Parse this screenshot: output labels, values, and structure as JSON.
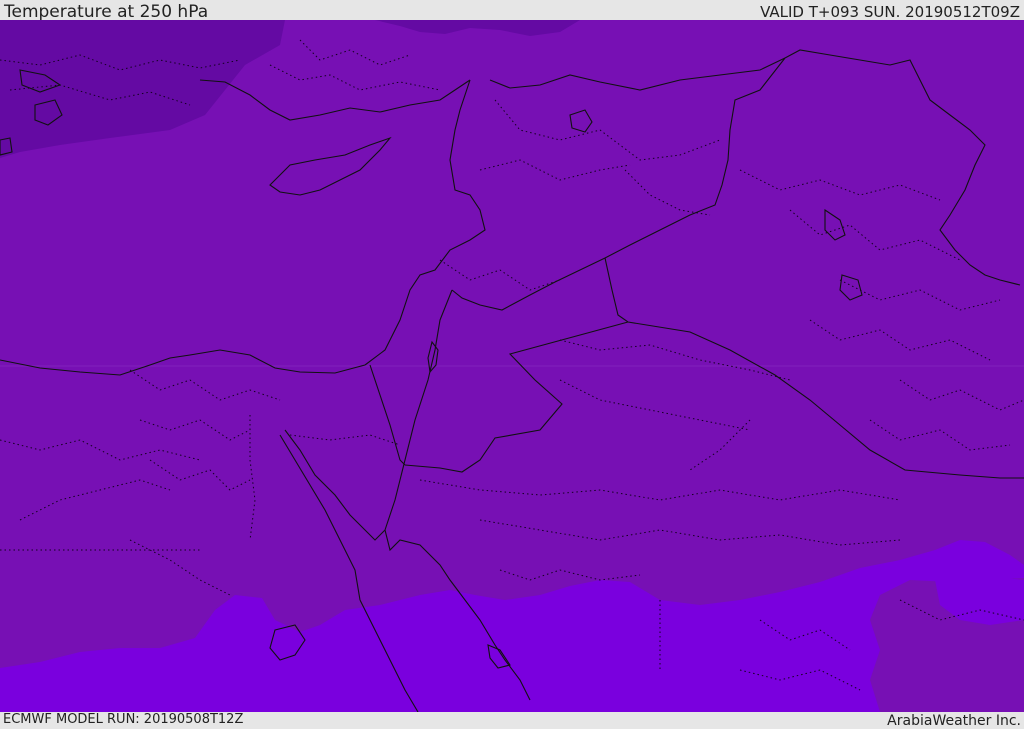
{
  "header": {
    "title": "Temperature at 250 hPa",
    "valid": "VALID T+093 SUN. 20190512T09Z"
  },
  "footer": {
    "model_run": "ECMWF MODEL RUN: 20190508T12Z",
    "credit": "ArabiaWeather Inc."
  },
  "colors": {
    "field_main": "#7710b4",
    "field_cold": "#640aa3",
    "field_warm": "#7a00de",
    "bar_bg": "#e6e6e6",
    "border": "#111111"
  }
}
